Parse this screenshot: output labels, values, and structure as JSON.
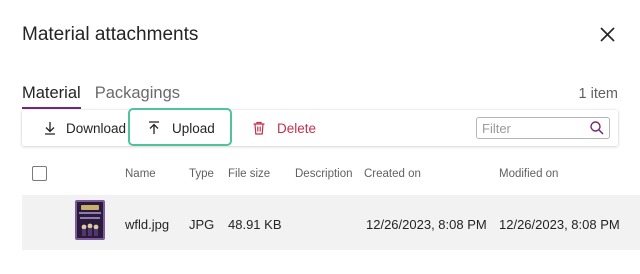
{
  "dialog": {
    "title": "Material attachments"
  },
  "tabs": [
    {
      "label": "Material"
    },
    {
      "label": "Packagings"
    }
  ],
  "item_count": "1 item",
  "toolbar": {
    "download_label": "Download",
    "upload_label": "Upload",
    "delete_label": "Delete",
    "filter_placeholder": "Filter"
  },
  "columns": [
    "Name",
    "Type",
    "File size",
    "Description",
    "Created on",
    "Modified on"
  ],
  "rows": [
    {
      "name": "wfld.jpg",
      "type": "JPG",
      "file_size": "48.91 KB",
      "description": "",
      "created_on": "12/26/2023, 8:08 PM",
      "modified_on": "12/26/2023, 8:08 PM"
    }
  ],
  "colors": {
    "accent": "#742774",
    "highlight": "#4fc399",
    "delete": "#c4314b"
  }
}
